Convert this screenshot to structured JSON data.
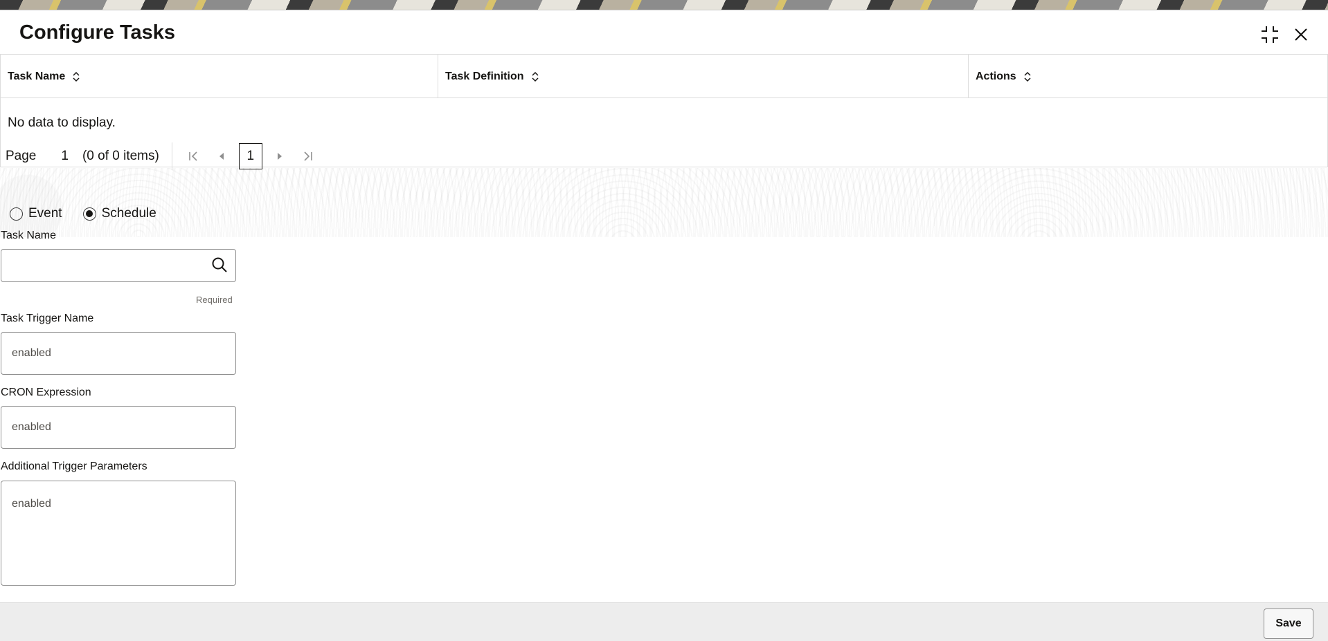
{
  "dialog": {
    "title": "Configure Tasks",
    "collapse_icon": "collapse-icon",
    "close_icon": "close-icon"
  },
  "table": {
    "columns": [
      {
        "label": "Task Name"
      },
      {
        "label": "Task Definition"
      },
      {
        "label": "Actions"
      }
    ],
    "empty_text": "No data to display.",
    "pager": {
      "page_label": "Page",
      "page_value": "1",
      "count_text": "(0 of 0 items)",
      "current_page": "1"
    }
  },
  "form": {
    "trigger_type": {
      "options": [
        "Event",
        "Schedule"
      ],
      "selected": "Schedule"
    },
    "task_name": {
      "label": "Task Name",
      "value": "",
      "hint": "Required"
    },
    "task_trigger_name": {
      "label": "Task Trigger Name",
      "value": "enabled"
    },
    "cron_expression": {
      "label": "CRON Expression",
      "value": "enabled"
    },
    "additional_trigger_parameters": {
      "label": "Additional Trigger Parameters",
      "value": "enabled"
    }
  },
  "footer": {
    "save_label": "Save"
  }
}
